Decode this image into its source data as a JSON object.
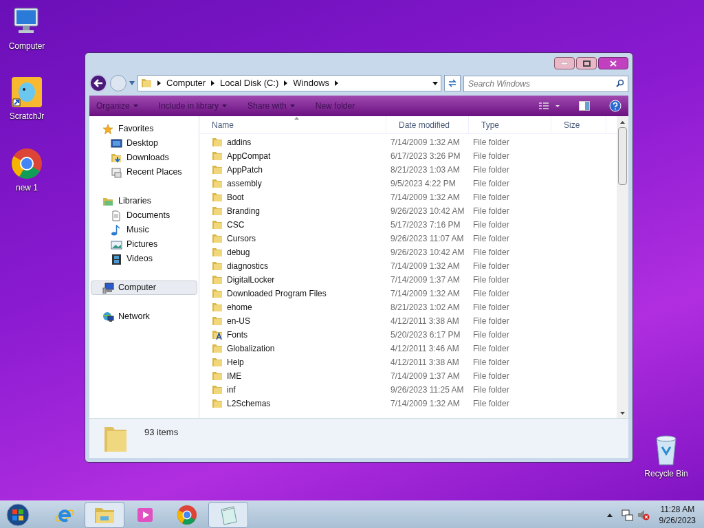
{
  "desktop_icons": [
    {
      "label": "Computer",
      "kind": "computer"
    },
    {
      "label": "ScratchJr",
      "kind": "scratch"
    },
    {
      "label": "new 1",
      "kind": "chrome"
    },
    {
      "label": "Recycle Bin",
      "kind": "recycle"
    }
  ],
  "window": {
    "address": [
      "Computer",
      "Local Disk (C:)",
      "Windows"
    ],
    "search": {
      "placeholder": "Search Windows"
    },
    "toolbar": [
      {
        "label": "Organize",
        "dropdown": true
      },
      {
        "label": "Include in library",
        "dropdown": true
      },
      {
        "label": "Share with",
        "dropdown": true
      },
      {
        "label": "New folder",
        "dropdown": false
      }
    ],
    "navigation": [
      {
        "label": "Favorites",
        "kind": "star",
        "selected": false,
        "children": [
          {
            "label": "Desktop",
            "kind": "desktop",
            "selected": false
          },
          {
            "label": "Downloads",
            "kind": "downloads",
            "selected": false
          },
          {
            "label": "Recent Places",
            "kind": "recent",
            "selected": false
          }
        ]
      },
      {
        "label": "Libraries",
        "kind": "library",
        "selected": false,
        "children": [
          {
            "label": "Documents",
            "kind": "document",
            "selected": false
          },
          {
            "label": "Music",
            "kind": "music",
            "selected": false
          },
          {
            "label": "Pictures",
            "kind": "picture",
            "selected": false
          },
          {
            "label": "Videos",
            "kind": "video",
            "selected": false
          }
        ]
      },
      {
        "label": "Computer",
        "kind": "computer",
        "selected": true
      },
      {
        "label": "Network",
        "kind": "network",
        "selected": false
      }
    ],
    "columns": [
      "Name",
      "Date modified",
      "Type",
      "Size"
    ],
    "rows": [
      {
        "name": "addins",
        "date": "7/14/2009 1:32 AM",
        "type": "File folder",
        "kind": "folder"
      },
      {
        "name": "AppCompat",
        "date": "6/17/2023 3:26 PM",
        "type": "File folder",
        "kind": "folder"
      },
      {
        "name": "AppPatch",
        "date": "8/21/2023 1:03 AM",
        "type": "File folder",
        "kind": "folder"
      },
      {
        "name": "assembly",
        "date": "9/5/2023 4:22 PM",
        "type": "File folder",
        "kind": "folder"
      },
      {
        "name": "Boot",
        "date": "7/14/2009 1:32 AM",
        "type": "File folder",
        "kind": "folder"
      },
      {
        "name": "Branding",
        "date": "9/26/2023 10:42 AM",
        "type": "File folder",
        "kind": "folder"
      },
      {
        "name": "CSC",
        "date": "5/17/2023 7:16 PM",
        "type": "File folder",
        "kind": "folder"
      },
      {
        "name": "Cursors",
        "date": "9/26/2023 11:07 AM",
        "type": "File folder",
        "kind": "folder"
      },
      {
        "name": "debug",
        "date": "9/26/2023 10:42 AM",
        "type": "File folder",
        "kind": "folder"
      },
      {
        "name": "diagnostics",
        "date": "7/14/2009 1:32 AM",
        "type": "File folder",
        "kind": "folder"
      },
      {
        "name": "DigitalLocker",
        "date": "7/14/2009 1:37 AM",
        "type": "File folder",
        "kind": "folder"
      },
      {
        "name": "Downloaded Program Files",
        "date": "7/14/2009 1:32 AM",
        "type": "File folder",
        "kind": "folder"
      },
      {
        "name": "ehome",
        "date": "8/21/2023 1:02 AM",
        "type": "File folder",
        "kind": "folder"
      },
      {
        "name": "en-US",
        "date": "4/12/2011 3:38 AM",
        "type": "File folder",
        "kind": "folder"
      },
      {
        "name": "Fonts",
        "date": "5/20/2023 6:17 PM",
        "type": "File folder",
        "kind": "fonts"
      },
      {
        "name": "Globalization",
        "date": "4/12/2011 3:46 AM",
        "type": "File folder",
        "kind": "folder"
      },
      {
        "name": "Help",
        "date": "4/12/2011 3:38 AM",
        "type": "File folder",
        "kind": "folder"
      },
      {
        "name": "IME",
        "date": "7/14/2009 1:37 AM",
        "type": "File folder",
        "kind": "folder"
      },
      {
        "name": "inf",
        "date": "9/26/2023 11:25 AM",
        "type": "File folder",
        "kind": "folder"
      },
      {
        "name": "L2Schemas",
        "date": "7/14/2009 1:32 AM",
        "type": "File folder",
        "kind": "folder"
      }
    ],
    "status": "93 items"
  },
  "taskbar": {
    "buttons": [
      {
        "kind": "explorer",
        "active": true
      },
      {
        "kind": "media",
        "active": false
      },
      {
        "kind": "chrome",
        "active": false
      },
      {
        "kind": "notepad",
        "active": true
      }
    ],
    "time": "11:28 AM",
    "date": "9/26/2023"
  }
}
